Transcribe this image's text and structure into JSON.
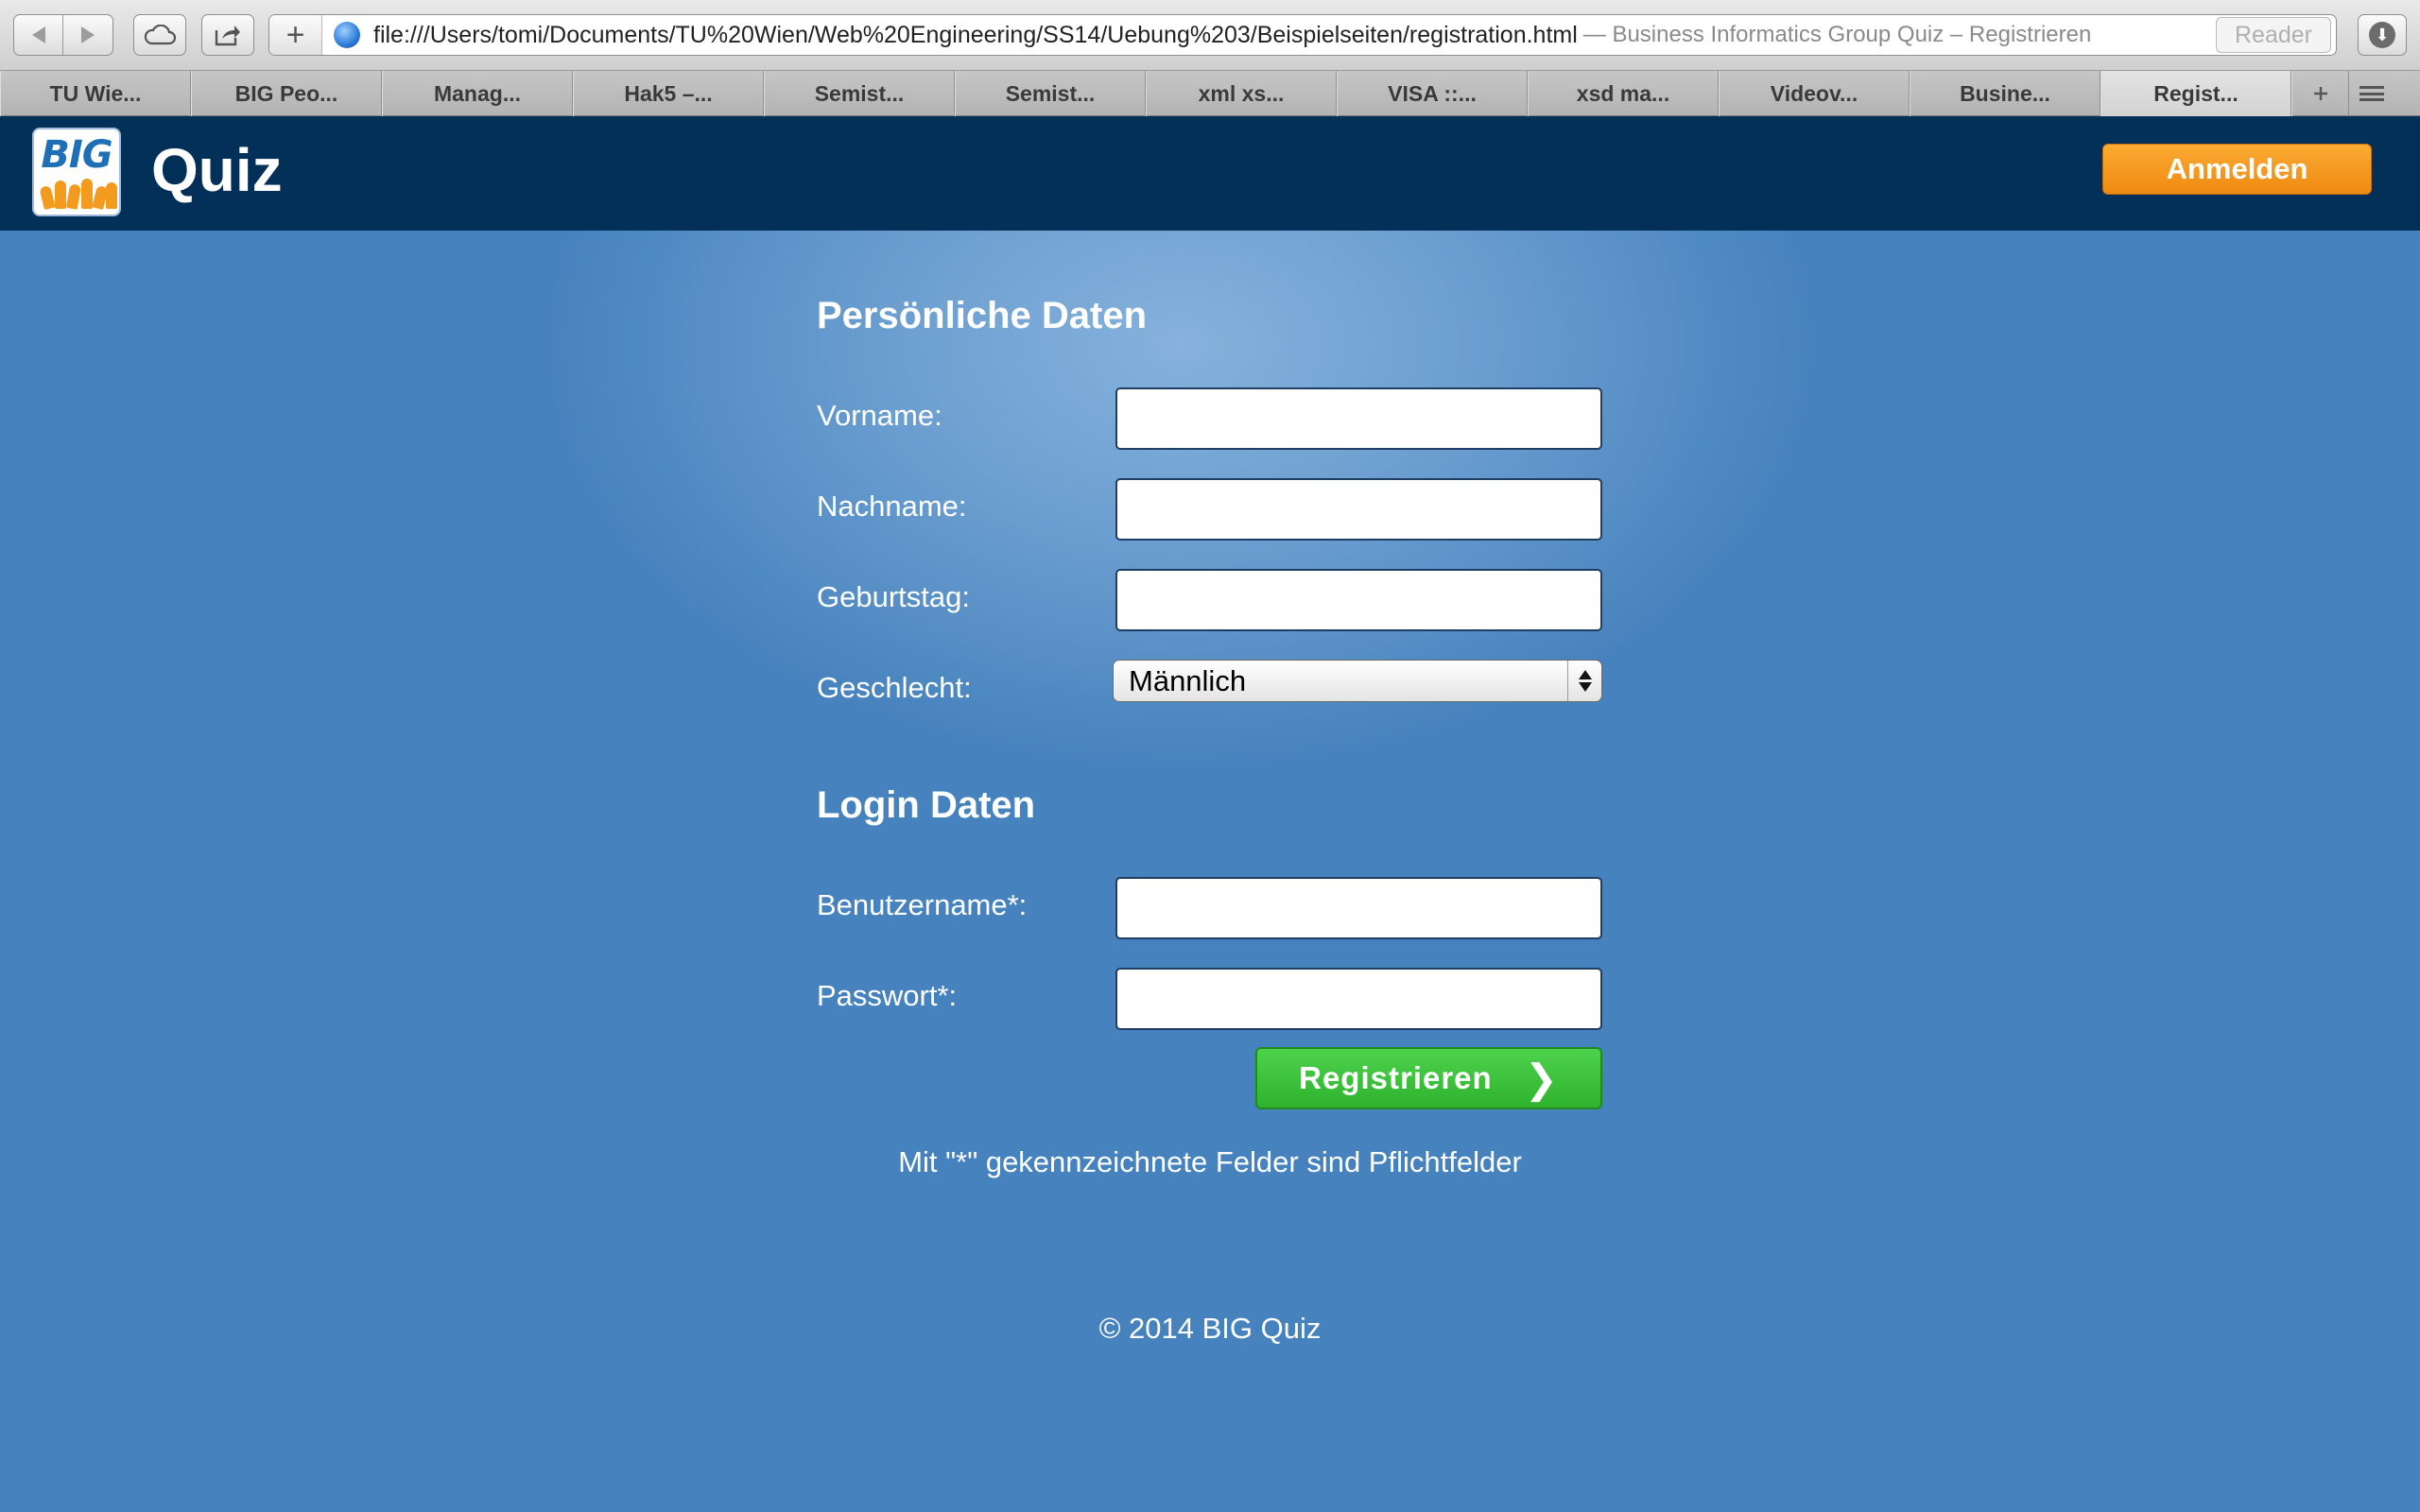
{
  "browser": {
    "url": "file:///Users/tomi/Documents/TU%20Wien/Web%20Engineering/SS14/Uebung%203/Beispielseiten/registration.html",
    "page_title": "— Business Informatics Group Quiz – Registrieren",
    "reader_label": "Reader",
    "new_tab_symbol": "+",
    "reload_symbol": "↻",
    "tabs": [
      {
        "label": "TU Wie..."
      },
      {
        "label": "BIG Peo..."
      },
      {
        "label": "Manag..."
      },
      {
        "label": "Hak5 –..."
      },
      {
        "label": "Semist..."
      },
      {
        "label": "Semist..."
      },
      {
        "label": "xml xs..."
      },
      {
        "label": "VISA ::..."
      },
      {
        "label": "xsd ma..."
      },
      {
        "label": "Videov..."
      },
      {
        "label": "Busine..."
      },
      {
        "label": "Regist..."
      }
    ],
    "active_tab": 11
  },
  "header": {
    "logo_text": "BIG",
    "title": "Quiz",
    "login_label": "Anmelden"
  },
  "personal": {
    "heading": "Persönliche Daten",
    "fields": [
      {
        "label": "Vorname:",
        "value": ""
      },
      {
        "label": "Nachname:",
        "value": ""
      },
      {
        "label": "Geburtstag:",
        "value": ""
      }
    ],
    "gender": {
      "label": "Geschlecht:",
      "selected": "Männlich"
    }
  },
  "login": {
    "heading": "Login Daten",
    "fields": [
      {
        "label": "Benutzername*:",
        "value": ""
      },
      {
        "label": "Passwort*:",
        "value": ""
      }
    ]
  },
  "register_label": "Registrieren",
  "register_chevron": "❯",
  "required_note": "Mit \"*\" gekennzeichnete Felder sind Pflichtfelder",
  "footer": "© 2014 BIG Quiz",
  "colors": {
    "header_bg": "#033058",
    "page_bg": "#4682bd",
    "login_button": "#f29a1f",
    "register_button": "#3ec23d"
  }
}
